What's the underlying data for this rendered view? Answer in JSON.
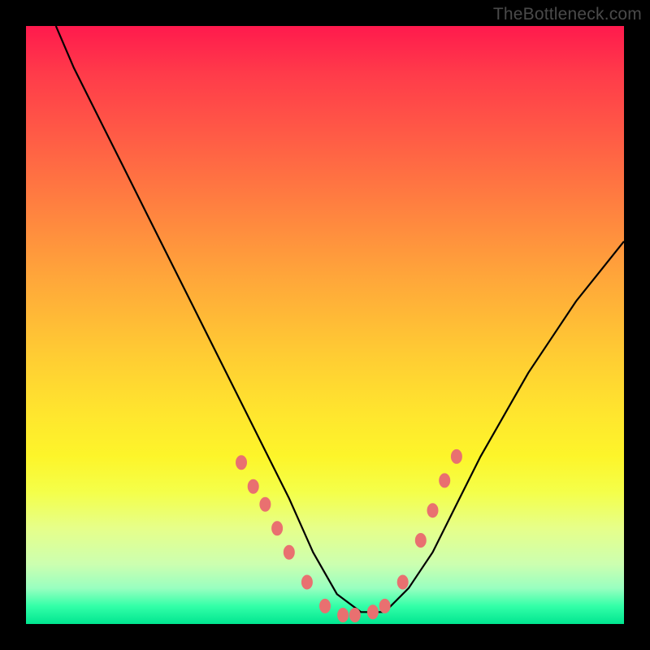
{
  "watermark": "TheBottleneck.com",
  "colors": {
    "curve": "#000000",
    "dots": "#e97070",
    "frame": "#000000"
  },
  "chart_data": {
    "type": "line",
    "title": "",
    "xlabel": "",
    "ylabel": "",
    "xlim": [
      0,
      100
    ],
    "ylim": [
      0,
      100
    ],
    "grid": false,
    "legend": false,
    "description": "V-shaped bottleneck curve descending steeply from upper-left, reaching a flat minimum near x≈48-60 at the bottom, then rising more gently toward upper-right",
    "series": [
      {
        "name": "bottleneck-curve",
        "x": [
          5,
          8,
          12,
          16,
          20,
          24,
          28,
          32,
          36,
          40,
          44,
          48,
          52,
          56,
          60,
          64,
          68,
          72,
          76,
          80,
          84,
          88,
          92,
          96,
          100
        ],
        "y": [
          100,
          93,
          85,
          77,
          69,
          61,
          53,
          45,
          37,
          29,
          21,
          12,
          5,
          2,
          2,
          6,
          12,
          20,
          28,
          35,
          42,
          48,
          54,
          59,
          64
        ]
      }
    ],
    "highlighted_points": [
      {
        "x": 36,
        "y": 27
      },
      {
        "x": 38,
        "y": 23
      },
      {
        "x": 40,
        "y": 20
      },
      {
        "x": 42,
        "y": 16
      },
      {
        "x": 44,
        "y": 12
      },
      {
        "x": 47,
        "y": 7
      },
      {
        "x": 50,
        "y": 3
      },
      {
        "x": 53,
        "y": 1.5
      },
      {
        "x": 55,
        "y": 1.5
      },
      {
        "x": 58,
        "y": 2
      },
      {
        "x": 60,
        "y": 3
      },
      {
        "x": 63,
        "y": 7
      },
      {
        "x": 66,
        "y": 14
      },
      {
        "x": 68,
        "y": 19
      },
      {
        "x": 70,
        "y": 24
      },
      {
        "x": 72,
        "y": 28
      }
    ]
  }
}
